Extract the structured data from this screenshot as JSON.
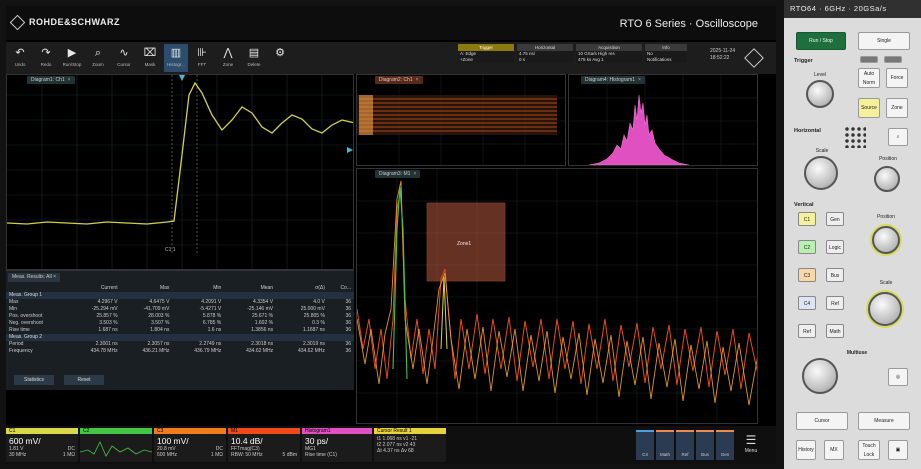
{
  "brand": "ROHDE&SCHWARZ",
  "series_title": "RTO 6 Series · Oscilloscope",
  "toolbar": {
    "undo": "Undo",
    "redo": "Redo",
    "run": "Run/Stop",
    "zoom": "Zoom",
    "cursor": "Cursor",
    "mask": "Mask",
    "histogram": "Histogr...",
    "fft": "FFT",
    "zone": "Zone",
    "delete": "Delete"
  },
  "status": {
    "trigger": {
      "header": "Trigger",
      "row1": "A: Edge",
      "row2": "+Zone"
    },
    "horizontal": {
      "header": "Horizontal",
      "row1": "4.75 ns/",
      "row2": "0 s"
    },
    "acquisition": {
      "header": "Acquisition",
      "row1": "10 GSa/s  High res",
      "row2": "475 ks  Avg 1"
    },
    "info": {
      "header": "Info",
      "row1": "No",
      "row2": "Notifications"
    },
    "date": "2025-11-24",
    "time": "18:52:22"
  },
  "windows": {
    "main_tab": "Diagram1: Ch1",
    "overview_tab": "Diagram2: Ch1",
    "histogram_tab": "Diagram4: Histogram1",
    "spectrum_tab": "Diagram3: M1",
    "zone_label": "Zone1",
    "cursor_label": "C1 1"
  },
  "measurements": {
    "tab": "Meas. Results: All",
    "columns": [
      "",
      "Current",
      "Max",
      "Min",
      "Mean",
      "σ(Δ)",
      "Co..."
    ],
    "group1": "Meas. Group 1",
    "rows1": [
      [
        "Max",
        "4.2967 V",
        "4.6475 V",
        "4.2091 V",
        "4.3354 V",
        "4.0 V",
        "36"
      ],
      [
        "Min",
        "-25.294 mV",
        "-41.709 mV",
        "-5.4271 V",
        "-25.146 mV",
        "25.000 mV",
        "36"
      ],
      [
        "Pos. overshoot",
        "25.857 %",
        "28.003 %",
        "5.878 %",
        "25.671 %",
        "25.805 %",
        "36"
      ],
      [
        "Neg. overshoot",
        "3.503 %",
        "3.507 %",
        "6.785 %",
        "1.602 %",
        "0.3 %",
        "36"
      ],
      [
        "Rise time",
        "1.687 ns",
        "1.804 ns",
        "1.6 ns",
        "1.3856 ns",
        "1.1687 ns",
        "36"
      ]
    ],
    "group2": "Meas. Group 2",
    "rows2": [
      [
        "Period",
        "2.3001 ns",
        "2.3057 ns",
        "2.2749 ns",
        "2.3018 ns",
        "2.3019 ns",
        "36"
      ],
      [
        "Frequency",
        "434.78 MHz",
        "436.21 MHz",
        "436.79 MHz",
        "434.62 MHz",
        "434.62 MHz",
        "36"
      ]
    ],
    "statistics_btn": "Statistics",
    "reset_btn": "Reset"
  },
  "bottom": {
    "c1": {
      "label": "C1",
      "value": "600 mV/",
      "l1": "1.81 V",
      "l2": "DC",
      "l3": "1 MΩ",
      "l4": "30 MHz",
      "l5": "100:1"
    },
    "c2": {
      "label": "C2"
    },
    "c3": {
      "label": "C3",
      "value": "100 mV/",
      "l1": "20.8 mV",
      "l2": "DC",
      "l3": "1 MΩ",
      "l4": "500 MHz"
    },
    "m1": {
      "label": "M1",
      "value": "10.4 dB/",
      "l1": "FFTmag(C3)",
      "l2": "RBW: 50 MHz",
      "l3": "5 dBm"
    },
    "hist": {
      "label": "Histogram1",
      "value": "30 ps/",
      "l1": "MG1",
      "l2": "Rise time (C1)"
    },
    "cursor": {
      "label": "Cursor Result 1",
      "l1": "t1  1.068 ns   v1  -21",
      "l2": "t2  2.077 ns   v2  43",
      "l3": "Δt  4.37 ns    Δv  68"
    },
    "right": [
      "C4",
      "Math",
      "Ref",
      "Bus",
      "Gen"
    ],
    "menu": "Menu"
  },
  "panel": {
    "title": "RTO64 · 6GHz · 20GSa/s",
    "run_stop": "Run / Stop",
    "single": "Single",
    "trigger": "Trigger",
    "level": "Level",
    "auto_norm": "Auto Norm",
    "force": "Force",
    "source": "Source",
    "zone": "Zone",
    "horizontal": "Horizontal",
    "scale": "Scale",
    "position": "Position",
    "vertical": "Vertical",
    "ch": [
      "C1",
      "C2",
      "C3",
      "C4"
    ],
    "gen": "Gen",
    "logic": "Logic",
    "bus": "Bus",
    "ref": "Ref",
    "math": "Math",
    "multiuse": "Multiuse",
    "cursor_btn": "Cursor",
    "measure_btn": "Measure",
    "history": "History",
    "mode_btn": "MX",
    "touch_lock": "Touch Lock"
  },
  "colors": {
    "ch1": "#d8d84a",
    "ch2": "#45c545",
    "ch3": "#f07d1a",
    "m1": "#f04a1a",
    "hist": "#e050c0",
    "trigger_yellow": "#e8d23a"
  }
}
